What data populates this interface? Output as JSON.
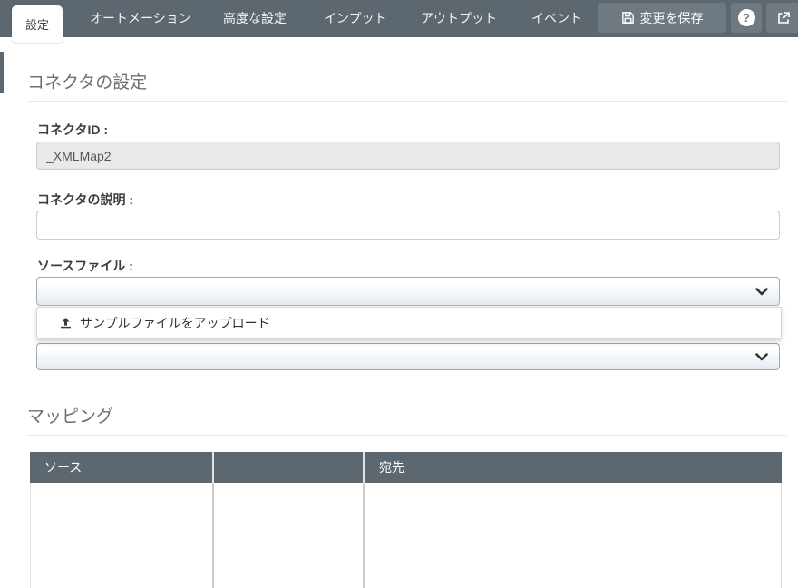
{
  "tabs": {
    "active_index": 0,
    "items": [
      {
        "label": "設定"
      },
      {
        "label": "オートメーション"
      },
      {
        "label": "高度な設定"
      },
      {
        "label": "インプット"
      },
      {
        "label": "アウトプット"
      },
      {
        "label": "イベント"
      }
    ]
  },
  "toolbar": {
    "save_label": "変更を保存",
    "help_glyph": "?"
  },
  "sections": {
    "connector": {
      "title": "コネクタの設定",
      "fields": {
        "id_label": "コネクタID :",
        "id_value": "_XMLMap2",
        "description_label": "コネクタの説明 :",
        "description_value": "",
        "source_file_label": "ソースファイル :",
        "source_file_selected": "",
        "upload_option_label": "サンプルファイルをアップロード",
        "second_select_selected": ""
      }
    },
    "mapping": {
      "title": "マッピング",
      "table": {
        "columns": [
          "ソース",
          "",
          "宛先"
        ]
      }
    }
  },
  "colors": {
    "topbar": "#5c6770",
    "toolbar_button": "#6e7982",
    "table_header": "#5c6770",
    "disabled_field_bg": "#e9e9e9",
    "heading_text": "#6f6f6f"
  }
}
